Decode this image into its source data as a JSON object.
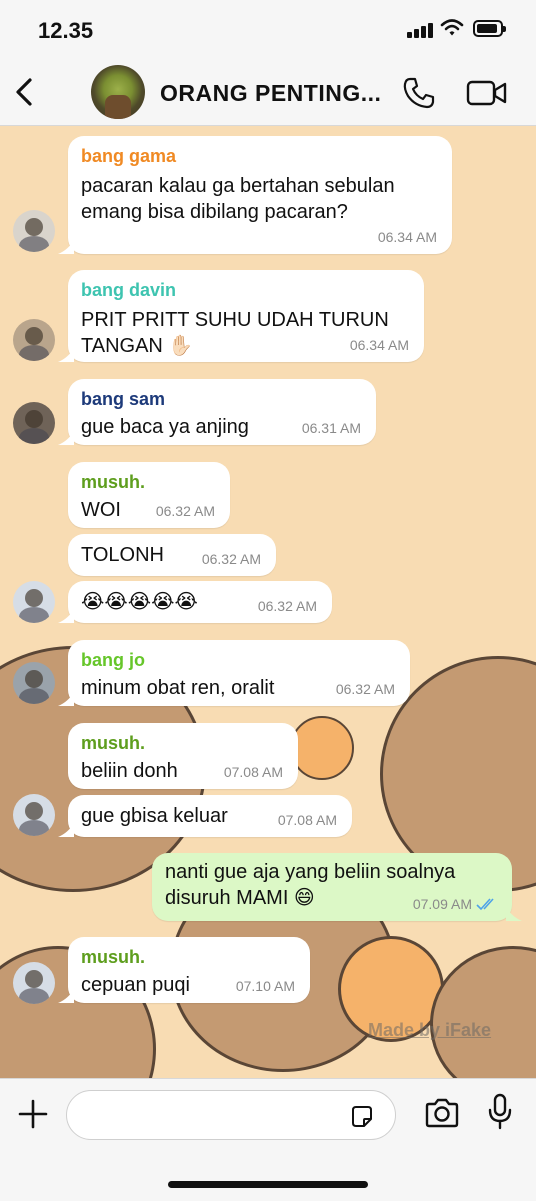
{
  "status_bar": {
    "time": "12.35"
  },
  "header": {
    "title": "ORANG PENTING..."
  },
  "colors": {
    "chat_bg": "#f8dcb3",
    "bubble_in": "#ffffff",
    "bubble_out": "#dcf8c6",
    "sender_gama": "#f08a24",
    "sender_davin": "#3ec4b0",
    "sender_sam": "#1d3a7a",
    "sender_musuh": "#5e9e1e",
    "sender_jo": "#66c62a",
    "read_ticks": "#4fa3e8"
  },
  "messages": [
    {
      "sender": "bang gama",
      "lines": [
        "pacaran kalau ga bertahan sebulan",
        "emang bisa dibilang pacaran?"
      ],
      "time": "06.34 AM"
    },
    {
      "sender": "bang davin",
      "lines": [
        "PRIT PRITT SUHU UDAH TURUN",
        "TANGAN ✋🏻"
      ],
      "time": "06.34 AM"
    },
    {
      "sender": "bang sam",
      "lines": [
        "gue baca ya anjing"
      ],
      "time": "06.31 AM"
    },
    {
      "sender": "musuh.",
      "lines": [
        "WOI"
      ],
      "time": "06.32 AM"
    },
    {
      "sender": "",
      "lines": [
        "TOLONH"
      ],
      "time": "06.32 AM"
    },
    {
      "sender": "",
      "lines": [
        "😭😭😭😭😭"
      ],
      "time": "06.32 AM"
    },
    {
      "sender": "bang jo",
      "lines": [
        "minum obat ren, oralit"
      ],
      "time": "06.32 AM"
    },
    {
      "sender": "musuh.",
      "lines": [
        "beliin donh"
      ],
      "time": "07.08 AM"
    },
    {
      "sender": "",
      "lines": [
        "gue gbisa keluar"
      ],
      "time": "07.08 AM"
    },
    {
      "sender": "",
      "lines": [
        "nanti gue aja yang beliin soalnya",
        "disuruh MAMI 😄"
      ],
      "time": "07.09 AM",
      "outgoing": true
    },
    {
      "sender": "musuh.",
      "lines": [
        "cepuan puqi"
      ],
      "time": "07.10 AM"
    }
  ],
  "watermark": "Made by iFake",
  "icons": [
    "back-chevron-icon",
    "phone-icon",
    "video-icon",
    "plus-icon",
    "sticker-icon",
    "camera-icon",
    "microphone-icon",
    "signal-icon",
    "wifi-icon",
    "battery-icon",
    "double-check-icon"
  ]
}
